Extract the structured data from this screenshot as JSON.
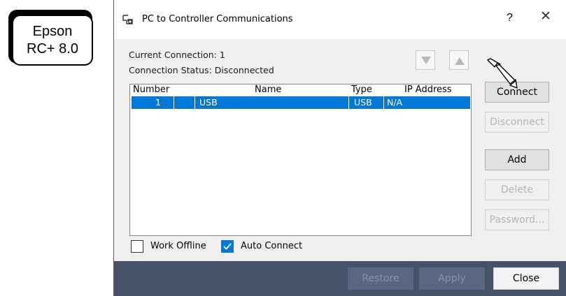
{
  "callout": {
    "line1": "Epson",
    "line2": "RC+ 8.0"
  },
  "dialog": {
    "title": "PC to Controller Communications",
    "help": "?",
    "close_glyph": "✕",
    "current_connection": "Current Connection: 1",
    "connection_status": "Connection Status: Disconnected",
    "list": {
      "columns": [
        "Number",
        "Name",
        "Type",
        "IP Address"
      ],
      "rows": [
        {
          "number": "1",
          "name": "USB",
          "type": "USB",
          "ip": "N/A",
          "selected": true
        }
      ]
    },
    "buttons": {
      "connect": "Connect",
      "disconnect": "Disconnect",
      "add": "Add",
      "delete": "Delete",
      "password": "Password..."
    },
    "checkboxes": {
      "work_offline": {
        "label": "Work Offline",
        "checked": false
      },
      "auto_connect": {
        "label": "Auto Connect",
        "checked": true
      }
    },
    "footer": {
      "restore": "Restore",
      "apply": "Apply",
      "close": "Close"
    }
  },
  "colors": {
    "selection": "#0078d7",
    "footer_bg": "#445167",
    "disabled_text": "#b5b5b5"
  },
  "icons": {
    "title": "controller-connection-icon",
    "move_down": "triangle-down-icon",
    "move_up": "triangle-up-icon",
    "pointer": "pointer-arrow-icon",
    "check": "checkmark-icon"
  }
}
